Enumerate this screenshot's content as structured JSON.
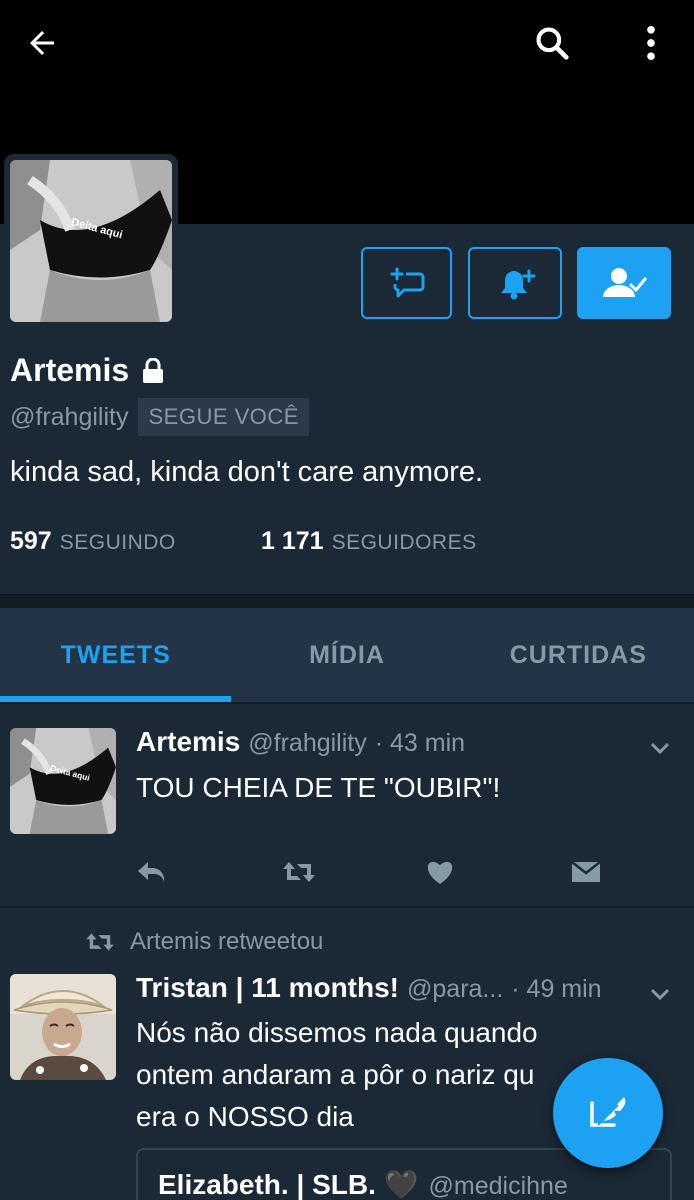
{
  "topbar": {
    "back_icon": "arrow-left-icon",
    "search_icon": "search-icon",
    "more_icon": "more-vertical-icon"
  },
  "profile": {
    "avatar_caption": "Deita aqui",
    "name": "Artemis",
    "handle": "@frahgility",
    "follows_you": "SEGUE VOCÊ",
    "bio": "kinda sad, kinda don't care anymore.",
    "following_count": "597",
    "following_label": "SEGUINDO",
    "followers_count": "1 171",
    "followers_label": "SEGUIDORES"
  },
  "actions": {
    "dm_icon": "message-plus-icon",
    "notify_icon": "bell-plus-icon",
    "following_icon": "user-check-icon"
  },
  "tabs": [
    {
      "label": "TWEETS",
      "active": true
    },
    {
      "label": "MÍDIA",
      "active": false
    },
    {
      "label": "CURTIDAS",
      "active": false
    }
  ],
  "tweets": [
    {
      "avatar_caption": "Deita aqui",
      "name": "Artemis",
      "handle": "@frahgility",
      "time": "· 43 min",
      "text": "TOU CHEIA DE TE \"OUBIR\"!"
    },
    {
      "retweeted_by": "Artemis retweetou",
      "name": "Tristan | 11 months!",
      "handle": "@para...",
      "time": "· 49 min",
      "text_lines": [
        "Nós não dissemos nada quando",
        "ontem andaram a pôr o nariz qu",
        "era o NOSSO dia"
      ],
      "quote": {
        "name": "Elizabeth. | SLB. 🖤",
        "handle": "@medicihne"
      }
    }
  ],
  "colors": {
    "accent": "#1da1f2",
    "background": "#1b2836",
    "header": "#000000",
    "muted": "#8899a6"
  }
}
